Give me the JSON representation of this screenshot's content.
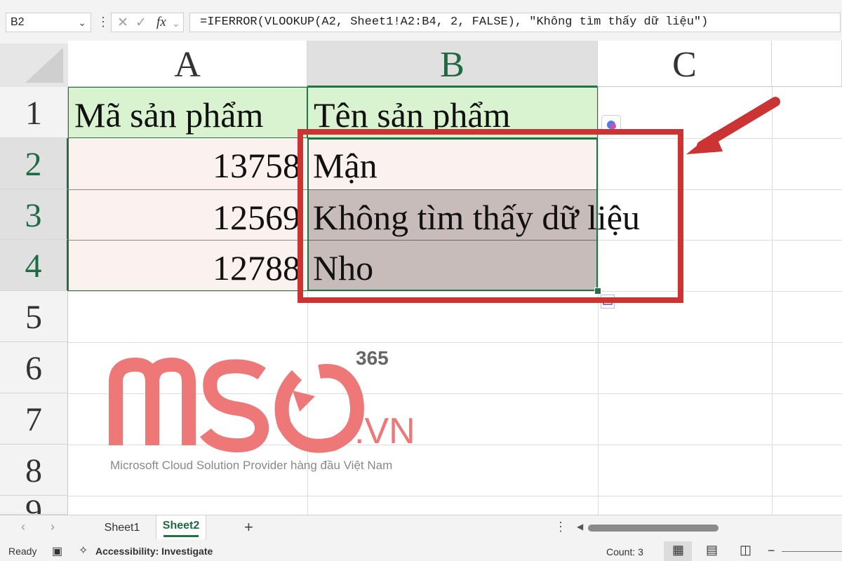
{
  "formula_bar": {
    "name_box": "B2",
    "formula": "=IFERROR(VLOOKUP(A2, Sheet1!A2:B4, 2, FALSE), \"Không tìm thấy dữ liệu\")"
  },
  "columns": [
    "A",
    "B",
    "C"
  ],
  "rows": [
    "1",
    "2",
    "3",
    "4",
    "5",
    "6",
    "7",
    "8",
    "9"
  ],
  "cells": {
    "A1": "Mã sản phẩm",
    "B1": "Tên sản phẩm",
    "A2": "13758",
    "B2": "Mận",
    "A3": "12569",
    "B3": "Không tìm thấy dữ liệu",
    "A4": "12788",
    "B4": "Nho"
  },
  "watermark": {
    "logo": "MSO",
    "superscript": "365",
    "domain": ".VN",
    "tagline": "Microsoft Cloud Solution Provider hàng đầu Việt Nam"
  },
  "sheet_tabs": [
    "Sheet1",
    "Sheet2"
  ],
  "active_sheet": "Sheet2",
  "status_bar": {
    "ready": "Ready",
    "accessibility": "Accessibility: Investigate",
    "count": "Count: 3"
  },
  "colors": {
    "header_fill": "#d9f2d0",
    "data_fill": "#fbf1ee",
    "lookup_fill": "#c8bcbb",
    "annotation_red": "#cc3333",
    "selection_green": "#217346",
    "watermark": "#ee7777"
  }
}
